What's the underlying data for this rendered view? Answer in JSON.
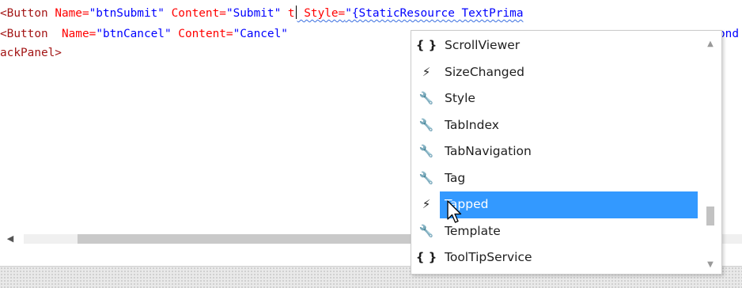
{
  "code": {
    "line1": {
      "open": "<Button",
      "name_attr": " Name=",
      "name_val": "\"btnSubmit\"",
      "content_attr": " Content=",
      "content_val": "\"Submit\"",
      "typed": " t",
      "style_attr": " Style=",
      "style_val": "\"{StaticResource TextPrima"
    },
    "line2": {
      "open": "<Button",
      "name_attr": "  Name=",
      "name_val": "\"btnCancel\"",
      "content_attr": " Content=",
      "content_val": "\"Cancel\"",
      "tail": "ond"
    },
    "line3": {
      "text": "ackPanel>"
    }
  },
  "intellisense": {
    "items": [
      {
        "label": "ScrollViewer",
        "icon": "braces-icon",
        "glyph": "{ }"
      },
      {
        "label": "SizeChanged",
        "icon": "event-icon",
        "glyph": "⚡"
      },
      {
        "label": "Style",
        "icon": "wrench-icon",
        "glyph": "🔧"
      },
      {
        "label": "TabIndex",
        "icon": "wrench-icon",
        "glyph": "🔧"
      },
      {
        "label": "TabNavigation",
        "icon": "wrench-icon",
        "glyph": "🔧"
      },
      {
        "label": "Tag",
        "icon": "wrench-icon",
        "glyph": "🔧"
      },
      {
        "label": "Tapped",
        "icon": "event-icon",
        "glyph": "⚡",
        "selected": true
      },
      {
        "label": "Template",
        "icon": "wrench-icon",
        "glyph": "🔧"
      },
      {
        "label": "ToolTipService",
        "icon": "braces-icon",
        "glyph": "{ }"
      }
    ]
  },
  "colors": {
    "tag": "#a31515",
    "attribute": "#ff0000",
    "value": "#0000ff",
    "selection": "#3399ff"
  }
}
